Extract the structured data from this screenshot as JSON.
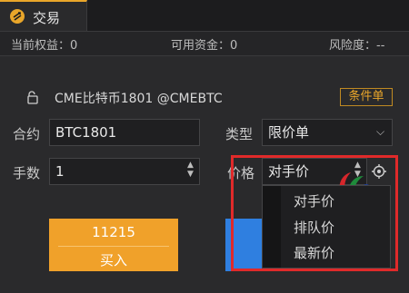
{
  "tab": {
    "label": "交易",
    "icon": "exchange-icon"
  },
  "status_bar": {
    "equity": "当前权益：0",
    "available": "可用资金：0",
    "risk": "风险度：--"
  },
  "product": {
    "name": "CME比特币1801 @CMEBTC",
    "conditional_label": "条件单"
  },
  "form": {
    "contract_label": "合约",
    "contract_value": "BTC1801",
    "type_label": "类型",
    "type_value": "限价单",
    "qty_label": "手数",
    "qty_value": "1",
    "price_label": "价格",
    "price_value": "对手价"
  },
  "buy_button": {
    "price": "11215",
    "action": "买入"
  },
  "price_dropdown": {
    "options": [
      "对手价",
      "排队价",
      "最新价"
    ]
  },
  "colors": {
    "accent": "#e9a62a",
    "buy": "#f0a12a",
    "sell": "#2f7fe0",
    "highlight": "#e02a2a"
  }
}
